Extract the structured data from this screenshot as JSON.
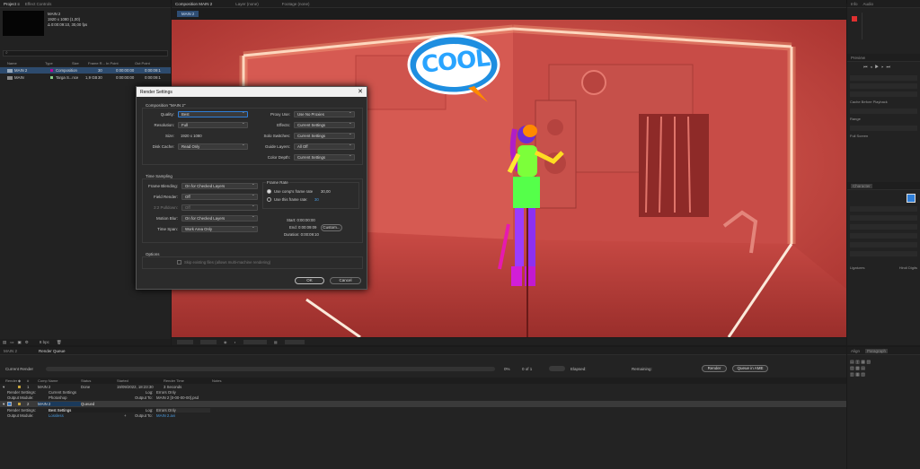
{
  "project": {
    "comp_name": "MAIN 2",
    "comp_size": "1920 x 1080 (1,00)",
    "comp_duration": "Δ 0:00:09:10, 30,00 fps",
    "columns": [
      "Name",
      "Type",
      "Size",
      "Frame R...",
      "In Point",
      "Out Point"
    ],
    "items": [
      {
        "name": "MAIN 2",
        "type": "Composition",
        "size": "",
        "fps": "30",
        "in": "0:00:00:00",
        "out": "0:00:09:1"
      },
      {
        "name": "MAIN",
        "type": "Targa S...nce",
        "size": "1,9 GB",
        "fps": "30",
        "in": "0:00:00:00",
        "out": "0:00:09:1"
      }
    ],
    "bottom_label": "8 bpc"
  },
  "viewer": {
    "tab": "Composition MAIN 2",
    "other_tabs": [
      "Layer (none)",
      "Footage (none)"
    ],
    "sub_tab": "MAIN 2",
    "sticker_text": "COOL"
  },
  "dialog": {
    "title": "Render Settings",
    "composition_label": "Composition \"MAIN 2\"",
    "left_fields": [
      {
        "label": "Quality:",
        "value": "Best"
      },
      {
        "label": "Resolution:",
        "value": "Full"
      },
      {
        "label": "Size:",
        "value": "1920 x 1080"
      },
      {
        "label": "Disk Cache:",
        "value": "Read Only"
      }
    ],
    "right_fields": [
      {
        "label": "Proxy Use:",
        "value": "Use No Proxies"
      },
      {
        "label": "Effects:",
        "value": "Current Settings"
      },
      {
        "label": "Solo Switches:",
        "value": "Current Settings"
      },
      {
        "label": "Guide Layers:",
        "value": "All Off"
      },
      {
        "label": "Color Depth:",
        "value": "Current Settings"
      }
    ],
    "time_sampling": {
      "section": "Time Sampling",
      "fields": [
        {
          "label": "Frame Blending:",
          "value": "On for Checked Layers"
        },
        {
          "label": "Field Render:",
          "value": "Off"
        },
        {
          "label": "3:2 Pulldown:",
          "value": "Off"
        },
        {
          "label": "Motion Blur:",
          "value": "On for Checked Layers"
        },
        {
          "label": "Time Span:",
          "value": "Work Area Only"
        }
      ],
      "frame_rate_title": "Frame Rate",
      "use_comp_rate": "Use comp's frame rate",
      "comp_rate_value": "30,00",
      "use_this_rate": "Use this frame rate:",
      "this_rate_value": "30",
      "start": "Start: 0:00:00:00",
      "end": "End: 0:00:09:09",
      "duration": "Duration: 0:00:09:10",
      "custom_button": "Custom..."
    },
    "options": {
      "section": "Options",
      "checkbox": "Skip existing files (allows multi-machine rendering)"
    },
    "ok": "OK",
    "cancel": "Cancel"
  },
  "render_queue": {
    "tabs": [
      "MAIN 2",
      "Render Queue"
    ],
    "current_render": "Current Render",
    "progress": "0%",
    "counter": "0 of 1",
    "elapsed": "Elapsed:",
    "remaining": "Remaining:",
    "queue_ame": "Queue in AME",
    "render": "Render",
    "columns": [
      "Render",
      "#",
      "Comp Name",
      "Status",
      "Started",
      "Render Time",
      "Notes"
    ],
    "items": [
      {
        "num": "1",
        "name": "MAIN 2",
        "status": "Done",
        "started": "19/09/2022, 18:23:30",
        "time": "3 Seconds",
        "render_settings_label": "Render Settings:",
        "render_settings_value": "Current Settings",
        "output_module_label": "Output Module:",
        "output_module_value": "Photoshop",
        "log_label": "Log:",
        "log_value": "Errors Only",
        "output_to_label": "Output To:",
        "output_to_value": "MAIN 2 [0-00-00-00].psd"
      },
      {
        "num": "2",
        "name": "MAIN 2",
        "status": "Queued",
        "started": "",
        "time": "",
        "render_settings_label": "Render Settings:",
        "render_settings_value": "Best Settings",
        "output_module_label": "Output Module:",
        "output_module_value": "Lossless",
        "log_label": "Log:",
        "log_value": "Errors Only",
        "output_to_label": "Output To:",
        "output_to_value": "MAIN 2.avi"
      }
    ]
  },
  "right_panels": {
    "tabs": [
      "Info",
      "Audio",
      "Preview",
      "Effects & Presets",
      "Align",
      "Libraries",
      "Character",
      "Paragraph",
      "Tracker",
      "Content-Aware Fill"
    ],
    "checkbox_labels": [
      "Cache Before Playback",
      "Range",
      "Full Screen",
      "Ligatures",
      "Hindi Digits"
    ]
  },
  "colors": {
    "accent": "#2f7ed8",
    "room": "#d8524e",
    "neon": "#ffe9d0"
  }
}
